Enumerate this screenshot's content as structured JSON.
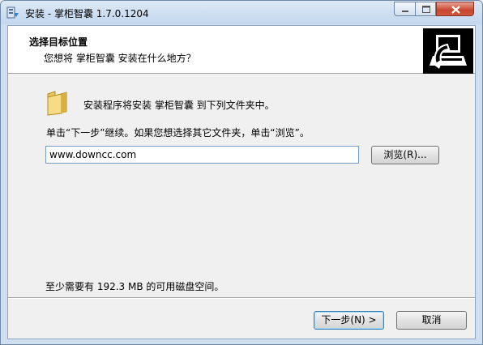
{
  "window": {
    "title": "安装 - 掌柜智囊 1.7.0.1204"
  },
  "header": {
    "title": "选择目标位置",
    "subtitle": "您想将 掌柜智囊 安装在什么地方？"
  },
  "body": {
    "info_text": "安装程序将安装 掌柜智囊 到下列文件夹中。",
    "instruction_text": "单击“下一步”继续。如果您想选择其它文件夹，单击“浏览”。",
    "install_path": "www.downcc.com",
    "browse_label": "浏览(R)...",
    "disk_space_text": "至少需要有 192.3 MB 的可用磁盘空间。"
  },
  "footer": {
    "next_label": "下一步(N) >",
    "cancel_label": "取消"
  },
  "icons": {
    "app": "installer-app-icon",
    "header": "computer-install-icon",
    "folder": "folder-icon"
  }
}
